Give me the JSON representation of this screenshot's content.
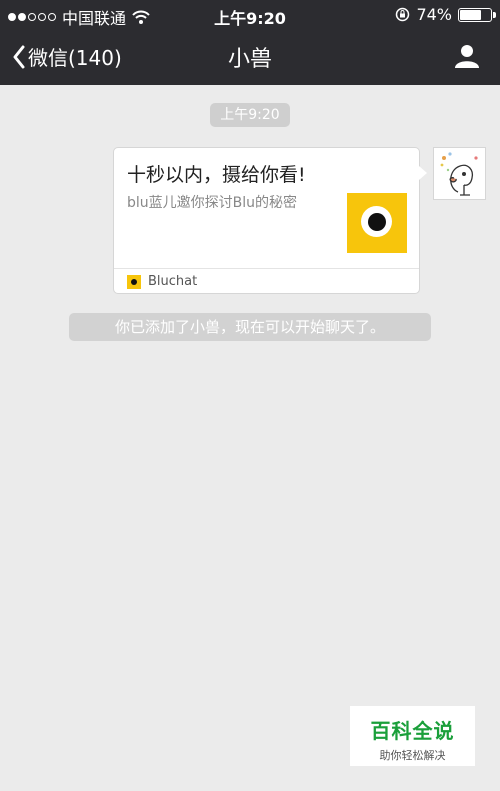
{
  "status_bar": {
    "carrier": "中国联通",
    "time": "上午9:20",
    "battery_percent": "74%",
    "battery_level": 0.74,
    "signal_bars_filled": 2,
    "signal_bars_total": 5
  },
  "nav": {
    "back_label": "微信(140)",
    "title": "小兽",
    "icons": {
      "back": "chevron-left-icon",
      "profile": "user-icon"
    }
  },
  "chat": {
    "timestamp": "上午9:20",
    "card": {
      "title": "十秒以内，摄给你看!",
      "description": "blu蓝儿邀你探讨Blu的秘密",
      "source": "Bluchat",
      "thumb_color": "#f7c50c"
    },
    "system_message": "你已添加了小兽，现在可以开始聊天了。"
  },
  "watermark": {
    "title": "百科全说",
    "subtitle": "助你轻松解决"
  }
}
